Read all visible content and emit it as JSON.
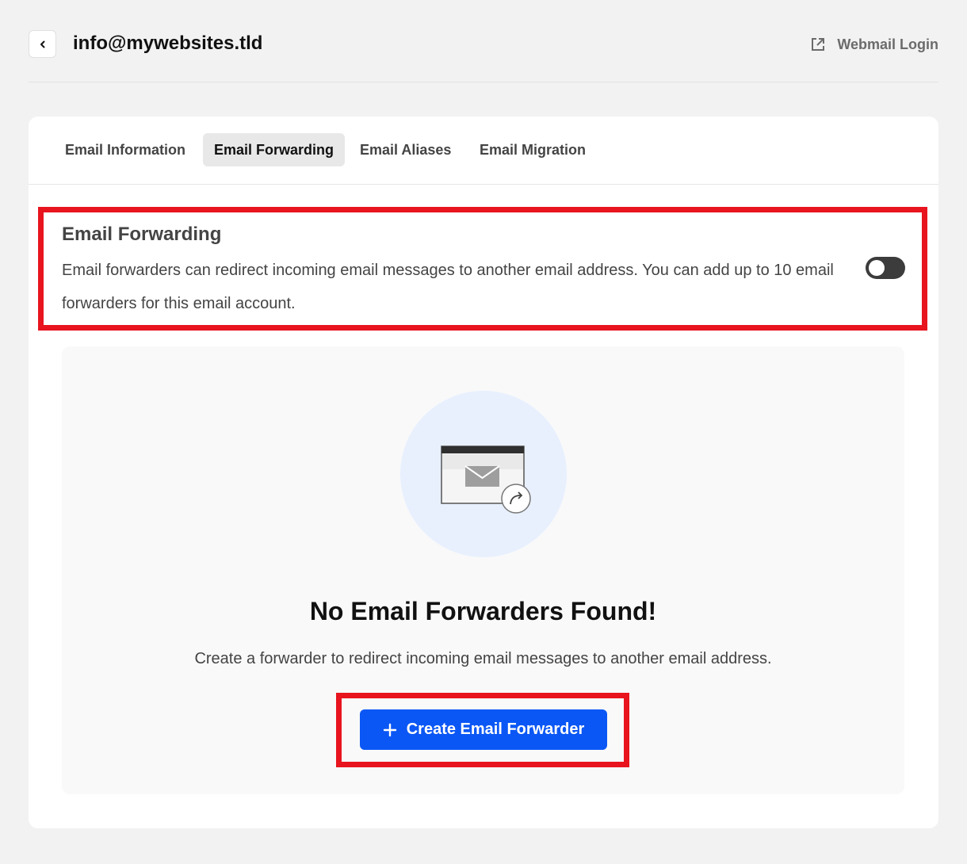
{
  "header": {
    "back_icon": "chevron-left-icon",
    "title": "info@mywebsites.tld",
    "webmail_icon": "external-link-icon",
    "webmail_label": "Webmail Login"
  },
  "tabs": [
    {
      "label": "Email Information",
      "active": false
    },
    {
      "label": "Email Forwarding",
      "active": true
    },
    {
      "label": "Email Aliases",
      "active": false
    },
    {
      "label": "Email Migration",
      "active": false
    }
  ],
  "forwarding": {
    "title": "Email Forwarding",
    "description": "Email forwarders can redirect incoming email messages to another email address. You can add up to 10 email forwarders for this email account.",
    "toggle_on": false
  },
  "empty_state": {
    "illustration_icon": "mail-forward-icon",
    "title": "No Email Forwarders Found!",
    "description": "Create a forwarder to redirect incoming email messages to another email address.",
    "button_icon": "plus-icon",
    "button_label": "Create Email Forwarder"
  },
  "colors": {
    "accent": "#0b57f5",
    "highlight": "#e8141e",
    "toggle": "#3c3c3c",
    "illustration_bg": "#e8f0fe"
  }
}
